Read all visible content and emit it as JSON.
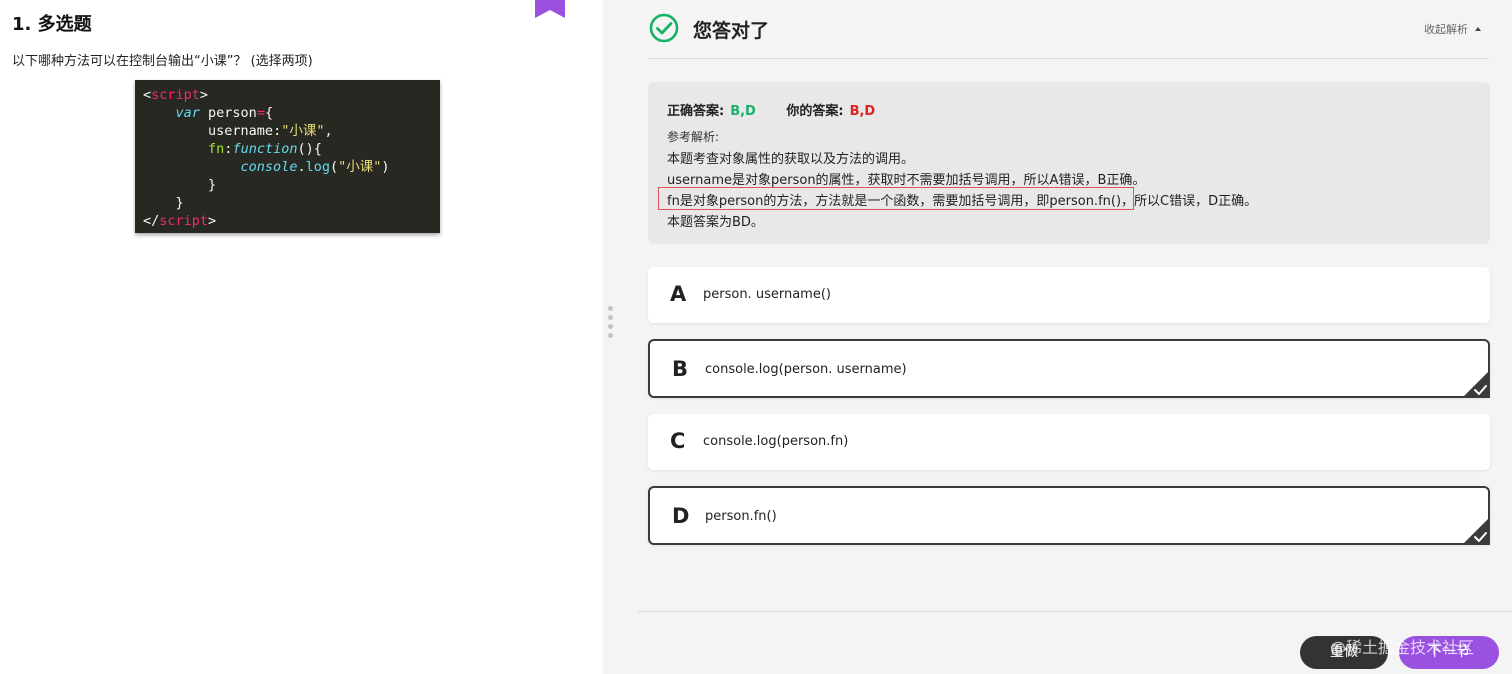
{
  "question": {
    "title": "1. 多选题",
    "text": "以下哪种方法可以在控制台输出“小课”？ (选择两项)",
    "code": {
      "open_tag": "script",
      "keyword_var": "var",
      "var_name": "person",
      "prop_username": "username",
      "str_value": "\"小课\"",
      "prop_fn": "fn",
      "keyword_function": "function",
      "console": "console",
      "log_call": "log",
      "close_tag": "script"
    }
  },
  "result": {
    "title": "您答对了",
    "collapse_label": "收起解析"
  },
  "analysis": {
    "correct_label": "正确答案:",
    "correct_value": "B,D",
    "your_label": "你的答案:",
    "your_value": "B,D",
    "ref_title": "参考解析:",
    "lines": [
      "本题考查对象属性的获取以及方法的调用。",
      "username是对象person的属性，获取时不需要加括号调用，所以A错误，B正确。",
      "fn是对象person的方法，方法就是一个函数，需要加括号调用，即person.fn()，所以C错误，D正确。",
      "本题答案为BD。"
    ]
  },
  "options": [
    {
      "letter": "A",
      "text": "person. username()",
      "selected": false
    },
    {
      "letter": "B",
      "text": "console.log(person. username)",
      "selected": true
    },
    {
      "letter": "C",
      "text": "console.log(person.fn)",
      "selected": false
    },
    {
      "letter": "D",
      "text": "person.fn()",
      "selected": true
    }
  ],
  "buttons": {
    "redo": "重做",
    "next": "下一节"
  },
  "watermark": "@稀土掘金技术社区",
  "colors": {
    "correct": "#17b26a",
    "yours": "#e02020",
    "accent": "#9b51e0",
    "highlight_border": "#e05555"
  }
}
